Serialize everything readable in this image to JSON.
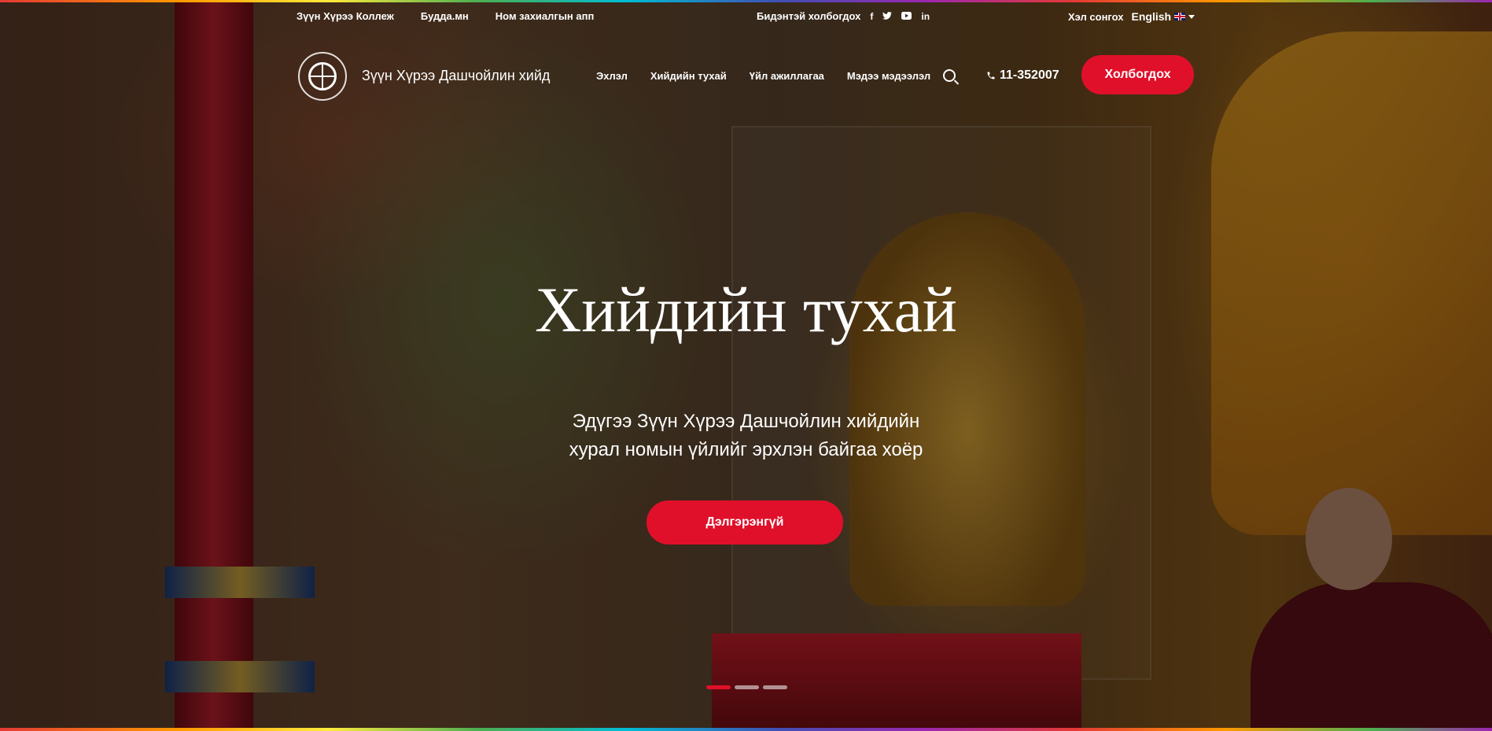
{
  "topbar": {
    "links": [
      "Зүүн Хүрээ Коллеж",
      "Будда.мн",
      "Ном захиалгын апп"
    ],
    "social_label": "Бидэнтэй холбогдох",
    "social_icons": [
      "facebook-icon",
      "twitter-icon",
      "youtube-icon",
      "linkedin-icon"
    ],
    "language_label": "Хэл сонгох",
    "language_current": "English"
  },
  "nav": {
    "site_name": "Зүүн Хүрээ Дашчойлин хийд",
    "items": [
      "Эхлэл",
      "Хийдийн тухай",
      "Үйл ажиллагаа",
      "Мэдээ мэдээлэл"
    ],
    "phone": "11-352007",
    "contact_button": "Холбогдох"
  },
  "hero": {
    "title": "Хийдийн тухай",
    "subtitle_line1": "Эдүгээ Зүүн Хүрээ Дашчойлин хийдийн",
    "subtitle_line2": "хурал номын үйлийг эрхлэн байгаа хоёр",
    "button": "Дэлгэрэнгүй",
    "slides_total": 3,
    "slide_active": 1
  },
  "colors": {
    "accent": "#e0102a"
  }
}
